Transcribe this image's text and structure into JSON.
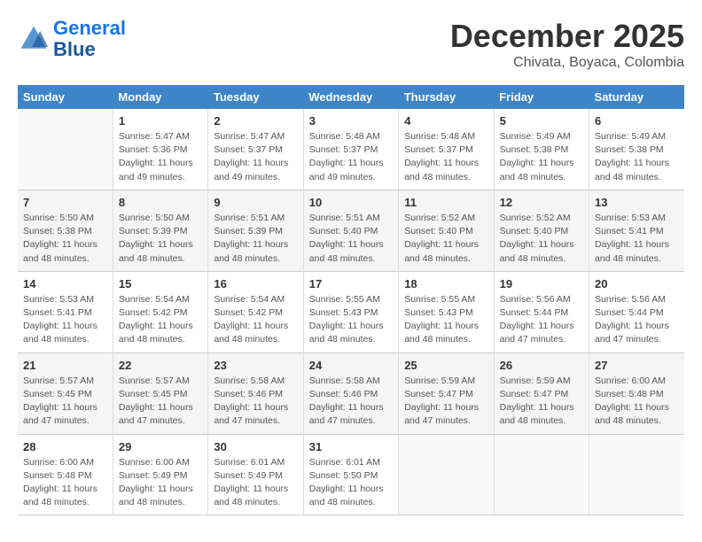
{
  "header": {
    "logo_line1": "General",
    "logo_line2": "Blue",
    "month": "December 2025",
    "location": "Chivata, Boyaca, Colombia"
  },
  "weekdays": [
    "Sunday",
    "Monday",
    "Tuesday",
    "Wednesday",
    "Thursday",
    "Friday",
    "Saturday"
  ],
  "weeks": [
    [
      {
        "day": "",
        "info": ""
      },
      {
        "day": "1",
        "info": "Sunrise: 5:47 AM\nSunset: 5:36 PM\nDaylight: 11 hours\nand 49 minutes."
      },
      {
        "day": "2",
        "info": "Sunrise: 5:47 AM\nSunset: 5:37 PM\nDaylight: 11 hours\nand 49 minutes."
      },
      {
        "day": "3",
        "info": "Sunrise: 5:48 AM\nSunset: 5:37 PM\nDaylight: 11 hours\nand 49 minutes."
      },
      {
        "day": "4",
        "info": "Sunrise: 5:48 AM\nSunset: 5:37 PM\nDaylight: 11 hours\nand 48 minutes."
      },
      {
        "day": "5",
        "info": "Sunrise: 5:49 AM\nSunset: 5:38 PM\nDaylight: 11 hours\nand 48 minutes."
      },
      {
        "day": "6",
        "info": "Sunrise: 5:49 AM\nSunset: 5:38 PM\nDaylight: 11 hours\nand 48 minutes."
      }
    ],
    [
      {
        "day": "7",
        "info": "Sunrise: 5:50 AM\nSunset: 5:38 PM\nDaylight: 11 hours\nand 48 minutes."
      },
      {
        "day": "8",
        "info": "Sunrise: 5:50 AM\nSunset: 5:39 PM\nDaylight: 11 hours\nand 48 minutes."
      },
      {
        "day": "9",
        "info": "Sunrise: 5:51 AM\nSunset: 5:39 PM\nDaylight: 11 hours\nand 48 minutes."
      },
      {
        "day": "10",
        "info": "Sunrise: 5:51 AM\nSunset: 5:40 PM\nDaylight: 11 hours\nand 48 minutes."
      },
      {
        "day": "11",
        "info": "Sunrise: 5:52 AM\nSunset: 5:40 PM\nDaylight: 11 hours\nand 48 minutes."
      },
      {
        "day": "12",
        "info": "Sunrise: 5:52 AM\nSunset: 5:40 PM\nDaylight: 11 hours\nand 48 minutes."
      },
      {
        "day": "13",
        "info": "Sunrise: 5:53 AM\nSunset: 5:41 PM\nDaylight: 11 hours\nand 48 minutes."
      }
    ],
    [
      {
        "day": "14",
        "info": "Sunrise: 5:53 AM\nSunset: 5:41 PM\nDaylight: 11 hours\nand 48 minutes."
      },
      {
        "day": "15",
        "info": "Sunrise: 5:54 AM\nSunset: 5:42 PM\nDaylight: 11 hours\nand 48 minutes."
      },
      {
        "day": "16",
        "info": "Sunrise: 5:54 AM\nSunset: 5:42 PM\nDaylight: 11 hours\nand 48 minutes."
      },
      {
        "day": "17",
        "info": "Sunrise: 5:55 AM\nSunset: 5:43 PM\nDaylight: 11 hours\nand 48 minutes."
      },
      {
        "day": "18",
        "info": "Sunrise: 5:55 AM\nSunset: 5:43 PM\nDaylight: 11 hours\nand 48 minutes."
      },
      {
        "day": "19",
        "info": "Sunrise: 5:56 AM\nSunset: 5:44 PM\nDaylight: 11 hours\nand 47 minutes."
      },
      {
        "day": "20",
        "info": "Sunrise: 5:56 AM\nSunset: 5:44 PM\nDaylight: 11 hours\nand 47 minutes."
      }
    ],
    [
      {
        "day": "21",
        "info": "Sunrise: 5:57 AM\nSunset: 5:45 PM\nDaylight: 11 hours\nand 47 minutes."
      },
      {
        "day": "22",
        "info": "Sunrise: 5:57 AM\nSunset: 5:45 PM\nDaylight: 11 hours\nand 47 minutes."
      },
      {
        "day": "23",
        "info": "Sunrise: 5:58 AM\nSunset: 5:46 PM\nDaylight: 11 hours\nand 47 minutes."
      },
      {
        "day": "24",
        "info": "Sunrise: 5:58 AM\nSunset: 5:46 PM\nDaylight: 11 hours\nand 47 minutes."
      },
      {
        "day": "25",
        "info": "Sunrise: 5:59 AM\nSunset: 5:47 PM\nDaylight: 11 hours\nand 47 minutes."
      },
      {
        "day": "26",
        "info": "Sunrise: 5:59 AM\nSunset: 5:47 PM\nDaylight: 11 hours\nand 48 minutes."
      },
      {
        "day": "27",
        "info": "Sunrise: 6:00 AM\nSunset: 5:48 PM\nDaylight: 11 hours\nand 48 minutes."
      }
    ],
    [
      {
        "day": "28",
        "info": "Sunrise: 6:00 AM\nSunset: 5:48 PM\nDaylight: 11 hours\nand 48 minutes."
      },
      {
        "day": "29",
        "info": "Sunrise: 6:00 AM\nSunset: 5:49 PM\nDaylight: 11 hours\nand 48 minutes."
      },
      {
        "day": "30",
        "info": "Sunrise: 6:01 AM\nSunset: 5:49 PM\nDaylight: 11 hours\nand 48 minutes."
      },
      {
        "day": "31",
        "info": "Sunrise: 6:01 AM\nSunset: 5:50 PM\nDaylight: 11 hours\nand 48 minutes."
      },
      {
        "day": "",
        "info": ""
      },
      {
        "day": "",
        "info": ""
      },
      {
        "day": "",
        "info": ""
      }
    ]
  ]
}
